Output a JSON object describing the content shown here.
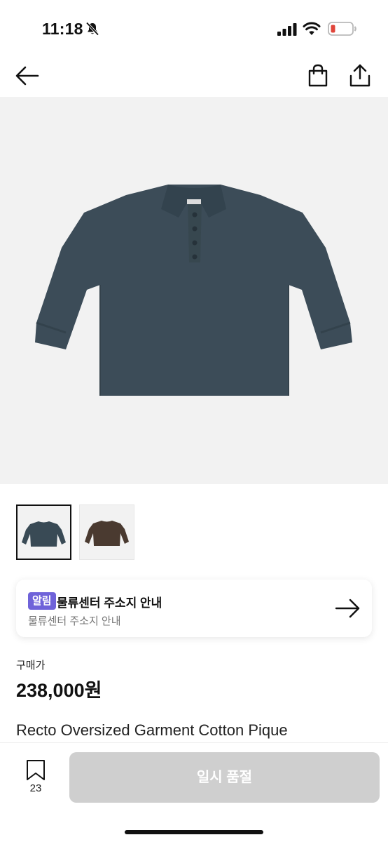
{
  "status_bar": {
    "time": "11:18"
  },
  "product": {
    "price_label": "구매가",
    "price": "238,000원",
    "name": "Recto Oversized Garment Cotton Pique"
  },
  "notice": {
    "badge": "알림",
    "title": "물류센터 주소지 안내",
    "subtitle": "물류센터 주소지 안내"
  },
  "bottom_bar": {
    "bookmark_count": "23",
    "action_label": "일시 품절"
  },
  "thumbnails": [
    {
      "color_name": "navy",
      "color": "#394a55",
      "selected": true
    },
    {
      "color_name": "brown",
      "color": "#4a3a30",
      "selected": false
    }
  ],
  "icons": [
    "bell-slash-icon",
    "signal-icon",
    "wifi-icon",
    "battery-icon",
    "back-arrow-icon",
    "shopping-bag-icon",
    "share-icon",
    "arrow-right-icon",
    "bookmark-icon"
  ],
  "colors": {
    "badge": "#6f63d9",
    "disabled_button": "#cfcfcf",
    "battery_low": "#e0453a",
    "hero_background": "#f2f2f2"
  }
}
